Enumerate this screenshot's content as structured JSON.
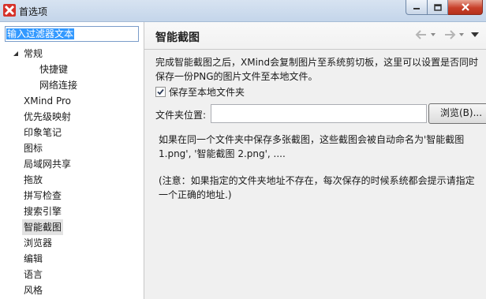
{
  "window": {
    "title": "首选项",
    "icon": "xmind-icon",
    "controls": [
      "minimize",
      "maximize",
      "close"
    ]
  },
  "sidebar": {
    "filter_text": "输入过滤器文本",
    "items": [
      {
        "label": "常规",
        "level": 0,
        "expanded": true
      },
      {
        "label": "快捷键",
        "level": 1
      },
      {
        "label": "网络连接",
        "level": 1
      },
      {
        "label": "XMind Pro",
        "level": 0
      },
      {
        "label": "优先级映射",
        "level": 0
      },
      {
        "label": "印象笔记",
        "level": 0
      },
      {
        "label": "图标",
        "level": 0
      },
      {
        "label": "局域网共享",
        "level": 0
      },
      {
        "label": "拖放",
        "level": 0
      },
      {
        "label": "拼写检查",
        "level": 0
      },
      {
        "label": "搜索引擎",
        "level": 0
      },
      {
        "label": "智能截图",
        "level": 0,
        "selected": true
      },
      {
        "label": "浏览器",
        "level": 0
      },
      {
        "label": "编辑",
        "level": 0
      },
      {
        "label": "语言",
        "level": 0
      },
      {
        "label": "风格",
        "level": 0
      }
    ]
  },
  "main": {
    "title": "智能截图",
    "description": "完成智能截图之后，XMind会复制图片至系统剪切板，这里可以设置是否同时保存一份PNG的图片文件至本地文件。",
    "save_checkbox": {
      "label": "保存至本地文件夹",
      "checked": true
    },
    "folder": {
      "label": "文件夹位置:",
      "value": "",
      "browse_label": "浏览(B)..."
    },
    "note": "如果在同一个文件夹中保存多张截图，这些截图会被自动命名为'智能截图 1.png', '智能截图 2.png', ....",
    "warning": "(注意：如果指定的文件夹地址不存在，每次保存的时候系统都会提示请指定一个正确的地址.)"
  }
}
